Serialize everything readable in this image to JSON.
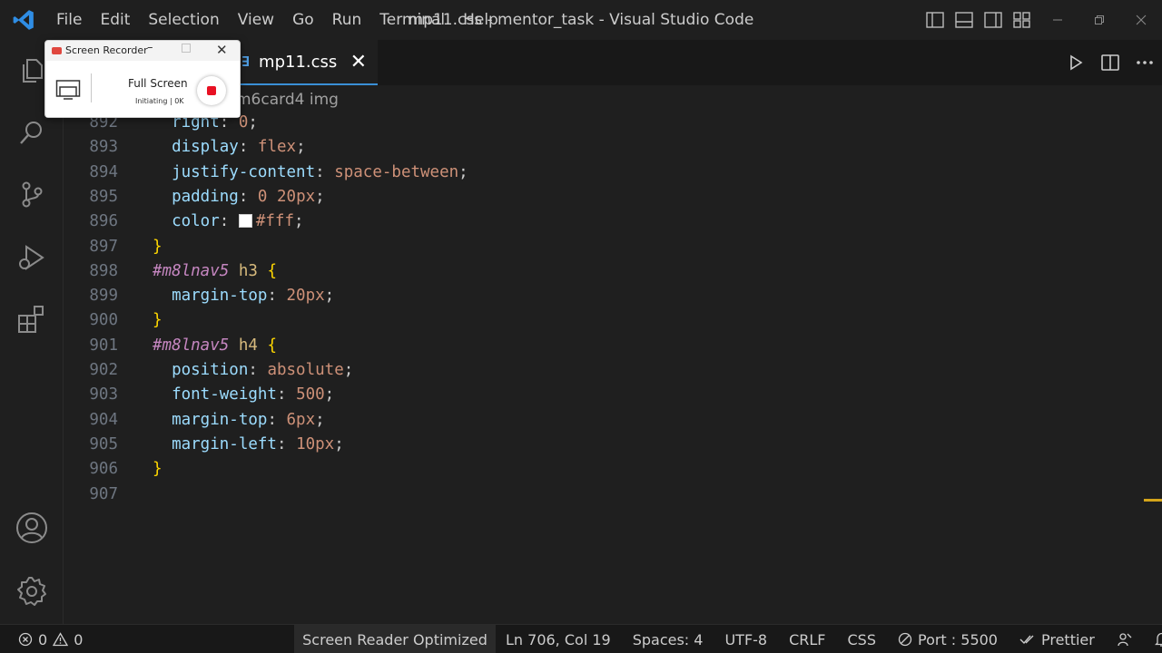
{
  "titlebar": {
    "menu": [
      "File",
      "Edit",
      "Selection",
      "View",
      "Go",
      "Run",
      "Terminal",
      "Help"
    ],
    "window_title": "mp11.css - mentor_task - Visual Studio Code"
  },
  "tab": {
    "icon_glyph": "∃",
    "label": "mp11.css",
    "close_glyph": "✕"
  },
  "breadcrumb": "m6card4 img",
  "code_lines": [
    {
      "n": "892",
      "prop": "right",
      "val": "0"
    },
    {
      "n": "893",
      "prop": "display",
      "val": "flex"
    },
    {
      "n": "894",
      "prop": "justify-content",
      "val": "space-between"
    },
    {
      "n": "895",
      "prop": "padding",
      "val": "0 20px"
    },
    {
      "n": "896",
      "prop": "color",
      "val": "#fff"
    },
    {
      "n": "897",
      "brace": "}"
    },
    {
      "n": "898",
      "sel_id": "#m8lnav5",
      "sel_tag": "h3",
      "open": "{"
    },
    {
      "n": "899",
      "prop": "margin-top",
      "val": "20px"
    },
    {
      "n": "900",
      "brace": "}"
    },
    {
      "n": "901",
      "sel_id": "#m8lnav5",
      "sel_tag": "h4",
      "open": "{"
    },
    {
      "n": "902",
      "prop": "position",
      "val": "absolute"
    },
    {
      "n": "903",
      "prop": "font-weight",
      "val": "500"
    },
    {
      "n": "904",
      "prop": "margin-top",
      "val": "6px"
    },
    {
      "n": "905",
      "prop": "margin-left",
      "val": "10px"
    },
    {
      "n": "906",
      "brace": "}"
    },
    {
      "n": "907"
    }
  ],
  "statusbar": {
    "errors": "0",
    "warnings": "0",
    "screen_reader": "Screen Reader Optimized",
    "position": "Ln 706, Col 19",
    "spaces": "Spaces: 4",
    "encoding": "UTF-8",
    "eol": "CRLF",
    "language": "CSS",
    "port": "Port : 5500",
    "prettier": "Prettier"
  },
  "recorder": {
    "title": "Screen Recorder",
    "mode": "Full Screen",
    "state": "Initiating | 0K"
  },
  "colors": {
    "accent": "#3a8fd6",
    "background": "#1f1f1f",
    "record": "#e81123"
  }
}
